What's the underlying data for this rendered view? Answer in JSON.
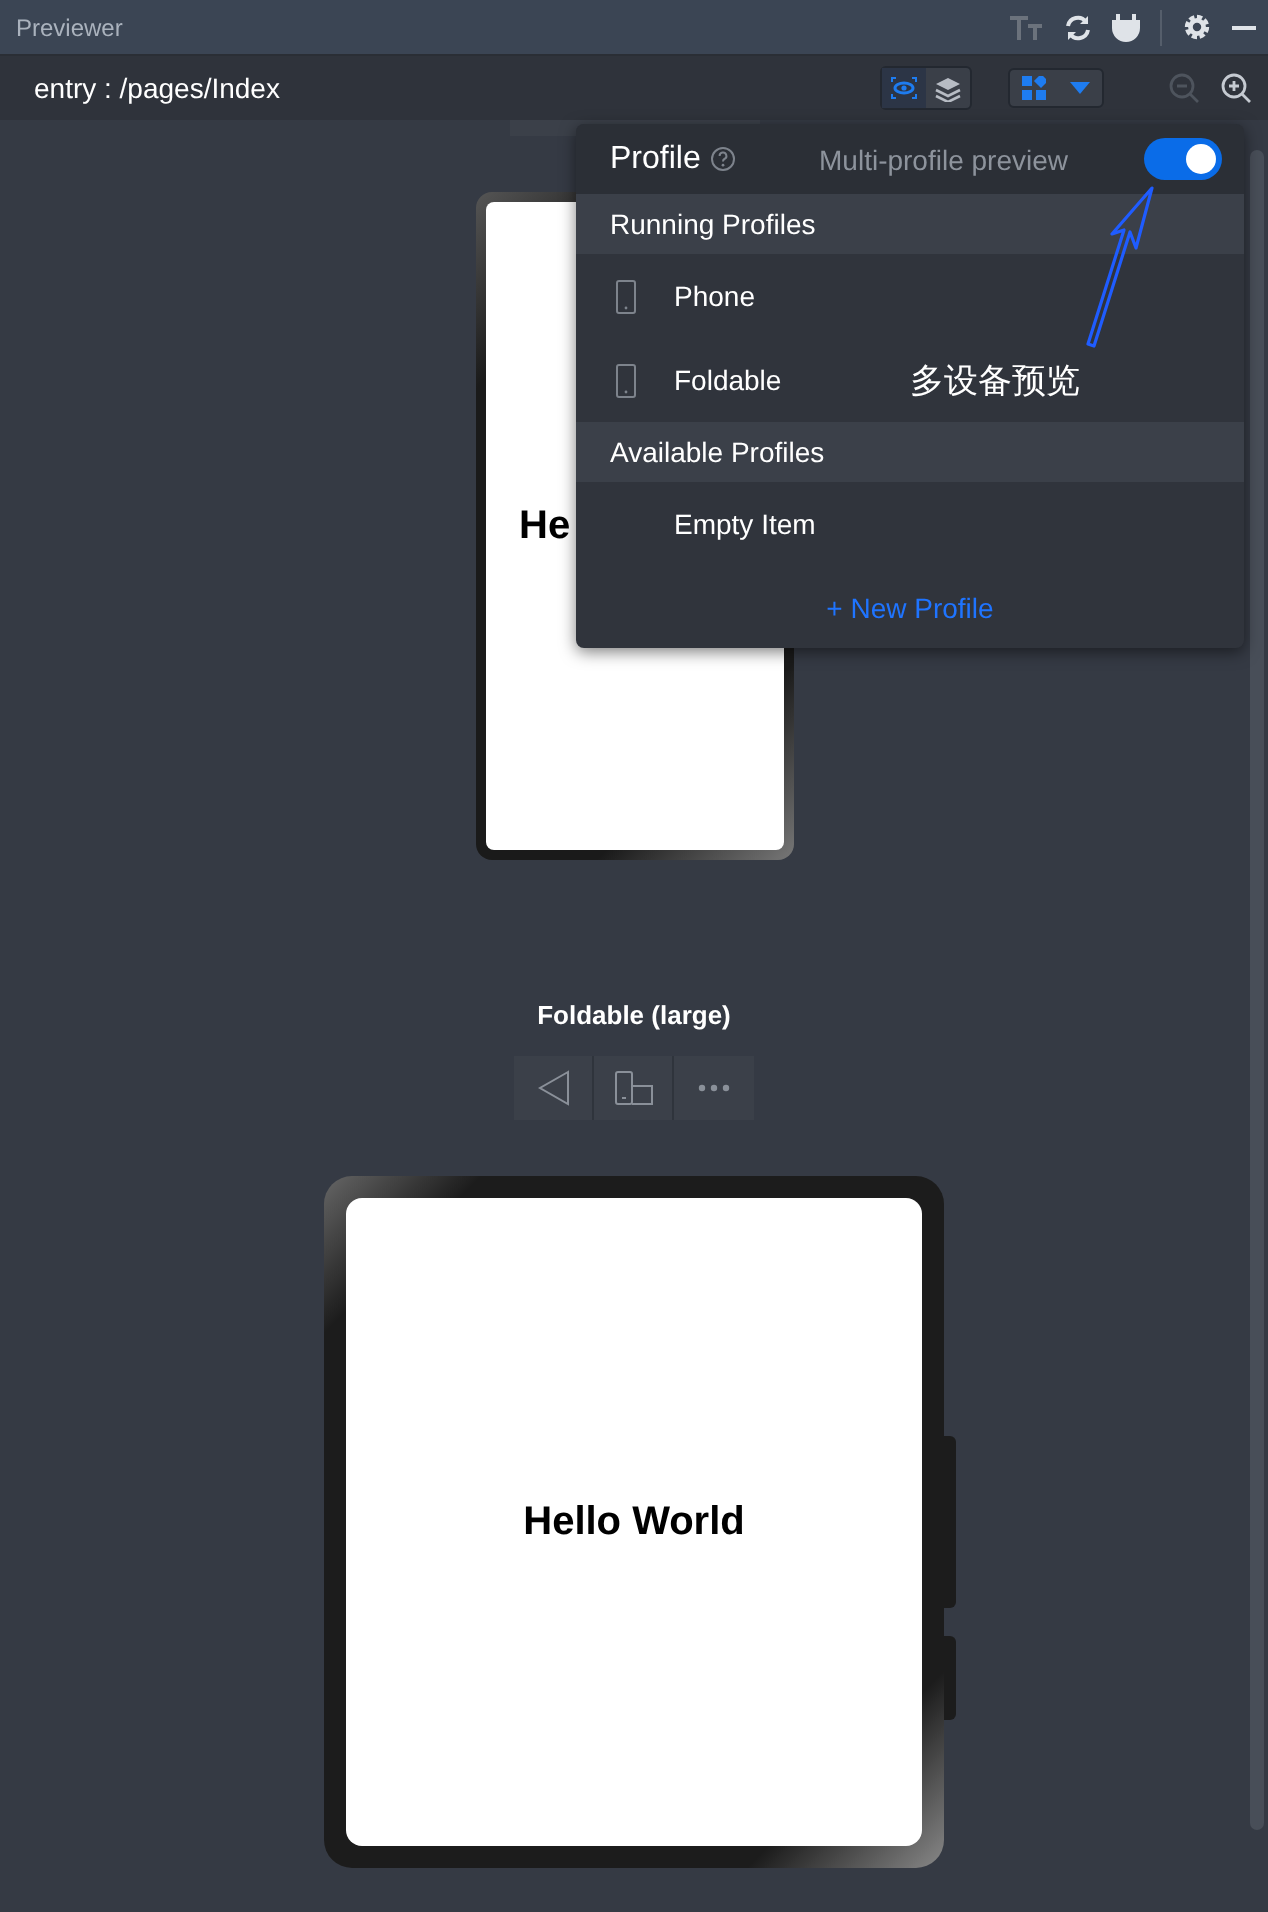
{
  "window": {
    "title": "Previewer"
  },
  "toolbar": {
    "page_path": "entry : /pages/Index",
    "view_modes": [
      {
        "selected": true
      },
      {
        "selected": false
      }
    ],
    "zoom_buttons": [
      {
        "disabled": true
      },
      {
        "disabled": false
      }
    ]
  },
  "devices": [
    {
      "kind": "phone",
      "screen_text": "He"
    },
    {
      "kind": "foldable",
      "label": "Foldable (large)",
      "screen_text": "Hello World"
    }
  ],
  "profile_popup": {
    "title": "Profile",
    "toggle_label": "Multi-profile preview",
    "multi_profile_on": true,
    "sections": [
      {
        "title": "Running Profiles",
        "items": [
          {
            "kind": "device",
            "label": "Phone"
          },
          {
            "kind": "device",
            "label": "Foldable"
          }
        ]
      },
      {
        "title": "Available Profiles",
        "items": [
          {
            "kind": "empty",
            "label": "Empty Item"
          }
        ]
      }
    ],
    "new_profile": "+ New Profile"
  },
  "annotation": {
    "text": "多设备预览"
  }
}
